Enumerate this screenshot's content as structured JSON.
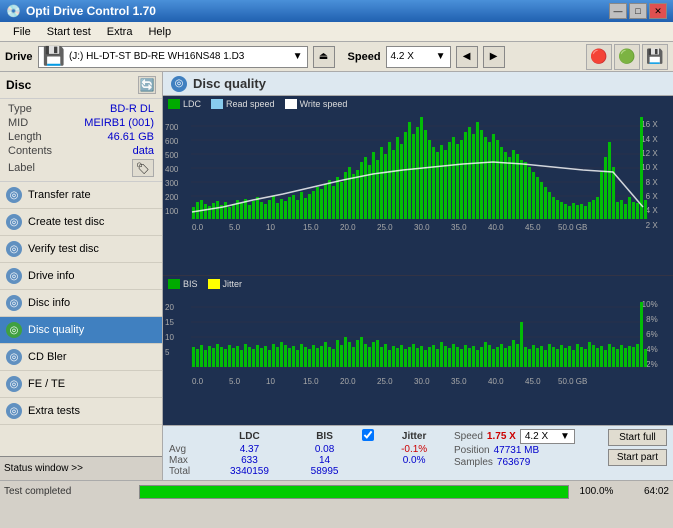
{
  "app": {
    "title": "Opti Drive Control 1.70",
    "icon": "💿"
  },
  "title_controls": {
    "minimize": "—",
    "maximize": "□",
    "close": "✕"
  },
  "menu": {
    "items": [
      "File",
      "Start test",
      "Extra",
      "Help"
    ]
  },
  "drive": {
    "label": "Drive",
    "selected": "(J:)  HL-DT-ST BD-RE  WH16NS48 1.D3",
    "speed_label": "Speed",
    "speed_value": "4.2 X"
  },
  "disc": {
    "title": "Disc",
    "type_label": "Type",
    "type_value": "BD-R DL",
    "mid_label": "MID",
    "mid_value": "MEIRB1 (001)",
    "length_label": "Length",
    "length_value": "46.61 GB",
    "contents_label": "Contents",
    "contents_value": "data",
    "label_label": "Label"
  },
  "nav": {
    "items": [
      {
        "id": "transfer-rate",
        "label": "Transfer rate",
        "active": false
      },
      {
        "id": "create-test-disc",
        "label": "Create test disc",
        "active": false
      },
      {
        "id": "verify-test-disc",
        "label": "Verify test disc",
        "active": false
      },
      {
        "id": "drive-info",
        "label": "Drive info",
        "active": false
      },
      {
        "id": "disc-info",
        "label": "Disc info",
        "active": false
      },
      {
        "id": "disc-quality",
        "label": "Disc quality",
        "active": true
      },
      {
        "id": "cd-bler",
        "label": "CD Bler",
        "active": false
      },
      {
        "id": "fe-te",
        "label": "FE / TE",
        "active": false
      },
      {
        "id": "extra-tests",
        "label": "Extra tests",
        "active": false
      }
    ]
  },
  "chart": {
    "title": "Disc quality",
    "legend1": {
      "ldc_color": "#00aa00",
      "ldc_label": "LDC",
      "read_color": "#aaddff",
      "read_label": "Read speed",
      "write_color": "#ffffff",
      "write_label": "Write speed"
    },
    "legend2": {
      "bis_color": "#00aa00",
      "bis_label": "BIS",
      "jitter_color": "#ffff00",
      "jitter_label": "Jitter"
    },
    "y_axis_top": [
      "700",
      "600",
      "500",
      "400",
      "300",
      "200",
      "100"
    ],
    "y_axis_right": [
      "16 X",
      "14 X",
      "12 X",
      "10 X",
      "8 X",
      "6 X",
      "4 X",
      "2 X"
    ],
    "x_axis": [
      "0.0",
      "5.0",
      "10",
      "15.0",
      "20.0",
      "25.0",
      "30.0",
      "35.0",
      "40.0",
      "45.0",
      "50.0 GB"
    ],
    "y_axis2_left": [
      "20",
      "15",
      "10",
      "5"
    ],
    "y_axis2_right": [
      "10%",
      "8%",
      "6%",
      "4%",
      "2%"
    ]
  },
  "stats": {
    "col1": "LDC",
    "col2": "BIS",
    "jitter_label": "Jitter",
    "speed_label": "Speed",
    "speed_value": "1.75 X",
    "speed_dropdown": "4.2 X",
    "position_label": "Position",
    "position_value": "47731 MB",
    "samples_label": "Samples",
    "samples_value": "763679",
    "avg_label": "Avg",
    "avg_ldc": "4.37",
    "avg_bis": "0.08",
    "avg_jitter": "-0.1%",
    "max_label": "Max",
    "max_ldc": "633",
    "max_bis": "14",
    "max_jitter": "0.0%",
    "total_label": "Total",
    "total_ldc": "3340159",
    "total_bis": "58995",
    "start_full": "Start full",
    "start_part": "Start part"
  },
  "status_window": {
    "label": "Status window >>",
    "arrows": "> >"
  },
  "status_bar": {
    "text": "Test completed",
    "progress": 100,
    "percent": "100.0%",
    "time": "64:02"
  }
}
